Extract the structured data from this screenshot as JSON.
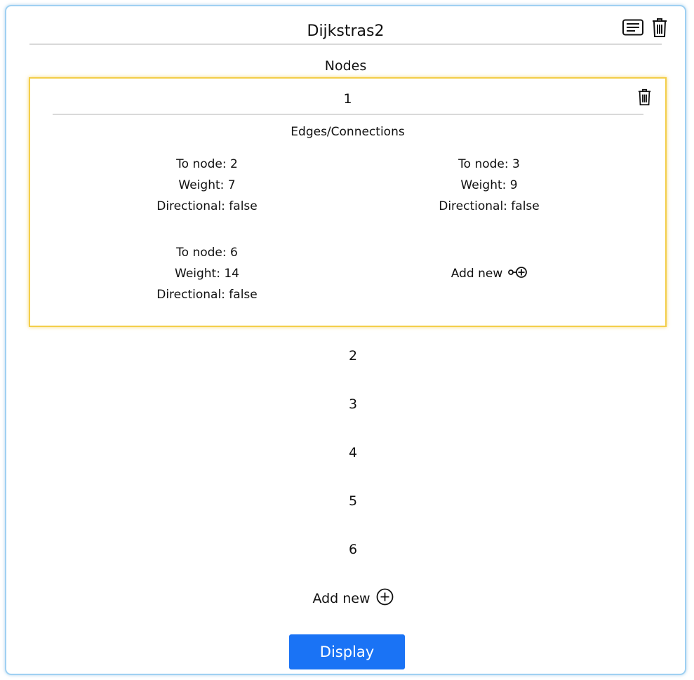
{
  "graph": {
    "title": "Dijkstras2"
  },
  "header": {
    "list_icon": "list-icon",
    "delete_icon": "trash-icon"
  },
  "nodes_section": {
    "heading": "Nodes",
    "expanded_node": {
      "label": "1",
      "edges_heading": "Edges/Connections",
      "edges": [
        {
          "to_node": "To node: 2",
          "weight": "Weight: 7",
          "directional": "Directional: false"
        },
        {
          "to_node": "To node: 3",
          "weight": "Weight: 9",
          "directional": "Directional: false"
        },
        {
          "to_node": "To node: 6",
          "weight": "Weight: 14",
          "directional": "Directional: false"
        }
      ],
      "add_edge_label": "Add new"
    },
    "other_nodes": [
      "2",
      "3",
      "4",
      "5",
      "6"
    ],
    "add_node_label": "Add new"
  },
  "actions": {
    "display_label": "Display"
  },
  "colors": {
    "card_border": "#9fd0f2",
    "node_highlight": "#f3ce4a",
    "primary_button": "#1a73f5",
    "divider": "#d9d9d9"
  }
}
